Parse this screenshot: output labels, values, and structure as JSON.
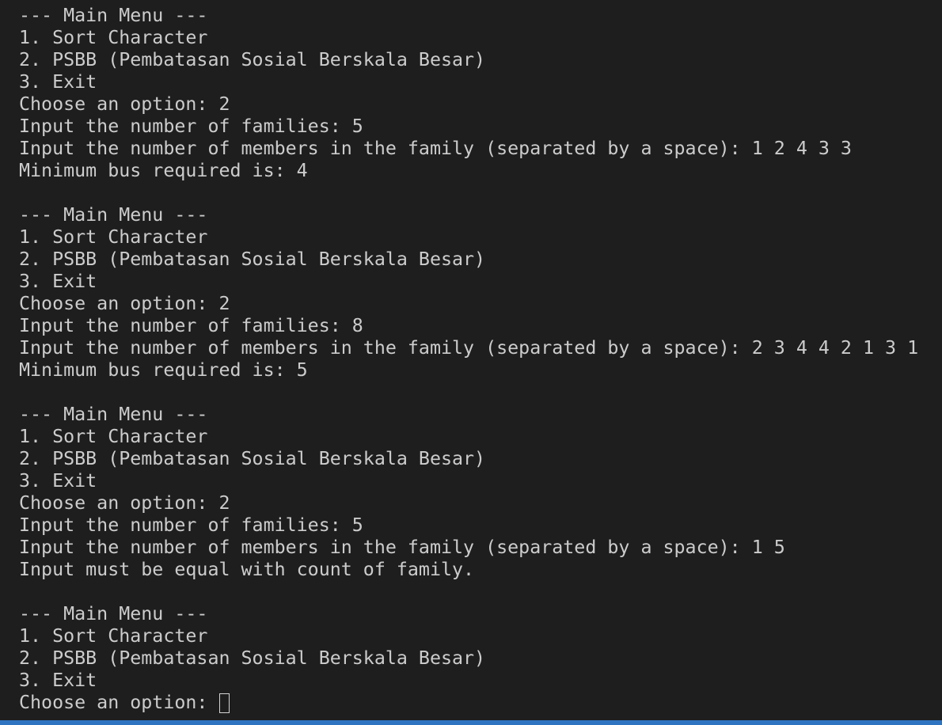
{
  "terminal": {
    "lines": [
      "--- Main Menu ---",
      "1. Sort Character",
      "2. PSBB (Pembatasan Sosial Berskala Besar)",
      "3. Exit",
      "Choose an option: 2",
      "Input the number of families: 5",
      "Input the number of members in the family (separated by a space): 1 2 4 3 3",
      "Minimum bus required is: 4",
      "",
      "--- Main Menu ---",
      "1. Sort Character",
      "2. PSBB (Pembatasan Sosial Berskala Besar)",
      "3. Exit",
      "Choose an option: 2",
      "Input the number of families: 8",
      "Input the number of members in the family (separated by a space): 2 3 4 4 2 1 3 1",
      "Minimum bus required is: 5",
      "",
      "--- Main Menu ---",
      "1. Sort Character",
      "2. PSBB (Pembatasan Sosial Berskala Besar)",
      "3. Exit",
      "Choose an option: 2",
      "Input the number of families: 5",
      "Input the number of members in the family (separated by a space): 1 5",
      "Input must be equal with count of family.",
      "",
      "--- Main Menu ---",
      "1. Sort Character",
      "2. PSBB (Pembatasan Sosial Berskala Besar)",
      "3. Exit"
    ],
    "prompt": "Choose an option: ",
    "colors": {
      "background": "#1e1e1e",
      "text": "#cccccc",
      "accent": "#2f74c0"
    }
  }
}
